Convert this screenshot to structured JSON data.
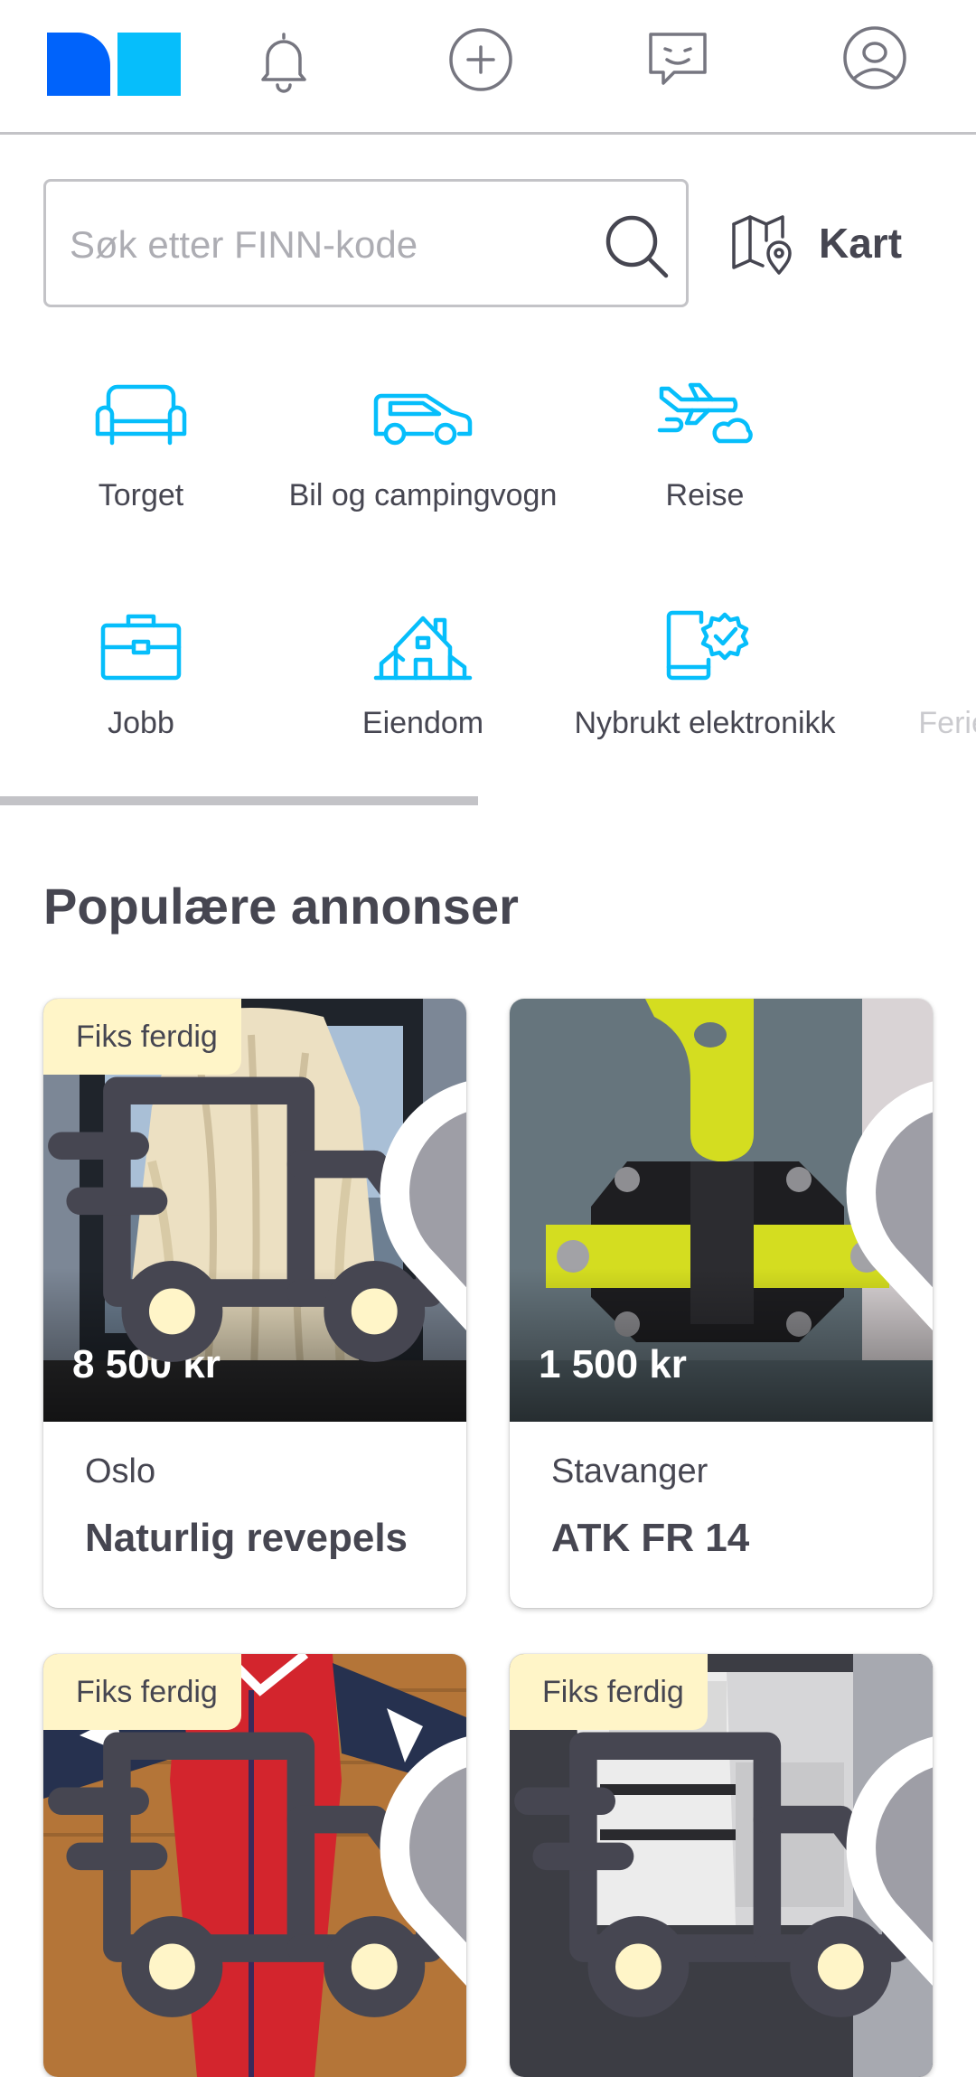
{
  "top_nav": {
    "items": [
      {
        "name": "notifications",
        "icon": "bell-icon"
      },
      {
        "name": "new-ad",
        "icon": "plus-circle-icon"
      },
      {
        "name": "messages",
        "icon": "message-smile-icon"
      },
      {
        "name": "profile",
        "icon": "user-circle-icon"
      }
    ],
    "colors": {
      "logo_dark": "#0063fb",
      "logo_light": "#06befb",
      "icon": "#767680"
    }
  },
  "search": {
    "placeholder": "Søk etter FINN-kode",
    "value": ""
  },
  "map": {
    "label": "Kart",
    "icon": "map-pin-icon"
  },
  "categories": [
    {
      "label": "Torget",
      "icon": "sofa-icon"
    },
    {
      "label": "Bil og campingvogn",
      "icon": "car-icon"
    },
    {
      "label": "Reise",
      "icon": "airplane-icon"
    },
    {
      "label": "Jobb",
      "icon": "briefcase-icon"
    },
    {
      "label": "Eiendom",
      "icon": "house-icon"
    },
    {
      "label": "Nybrukt elektronikk",
      "icon": "phone-check-icon"
    },
    {
      "label": "Feriehytte",
      "icon": "cabin-icon"
    }
  ],
  "category_scroll_progress": 0.37,
  "section_title": "Populære annonser",
  "ads": [
    {
      "badge": "Fiks ferdig",
      "price": "8 500 kr",
      "location": "Oslo",
      "title": "Naturlig revepels",
      "favorited": false
    },
    {
      "badge": "",
      "price": "1 500 kr",
      "location": "Stavanger",
      "title": "ATK FR 14",
      "favorited": false
    },
    {
      "badge": "Fiks ferdig",
      "price": "",
      "location": "",
      "title": "",
      "favorited": false
    },
    {
      "badge": "Fiks ferdig",
      "price": "",
      "location": "",
      "title": "",
      "favorited": false
    }
  ],
  "accent_color": "#06befb",
  "badge_color": "#fff5c8"
}
